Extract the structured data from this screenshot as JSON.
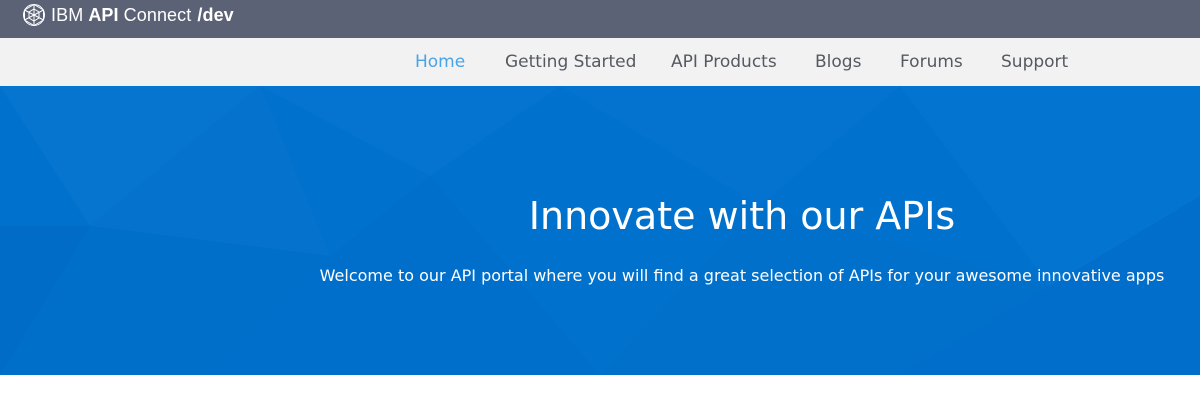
{
  "header": {
    "brand": {
      "ibm": "IBM",
      "api": "API",
      "connect": "Connect",
      "dev": "/dev",
      "logo_icon": "ibm-globe-logo-icon"
    }
  },
  "nav": {
    "items": [
      {
        "label": "Home",
        "active": true
      },
      {
        "label": "Getting Started",
        "active": false
      },
      {
        "label": "API Products",
        "active": false
      },
      {
        "label": "Blogs",
        "active": false
      },
      {
        "label": "Forums",
        "active": false
      },
      {
        "label": "Support",
        "active": false
      }
    ]
  },
  "hero": {
    "title": "Innovate with our APIs",
    "subtitle": "Welcome to our API portal where you will find a great selection of APIs for your awesome innovative apps"
  },
  "colors": {
    "topbar": "#5c6275",
    "navbar": "#f2f2f2",
    "nav_text": "#555a60",
    "nav_active": "#4aa3e6",
    "hero_bg": "#0071cd"
  }
}
